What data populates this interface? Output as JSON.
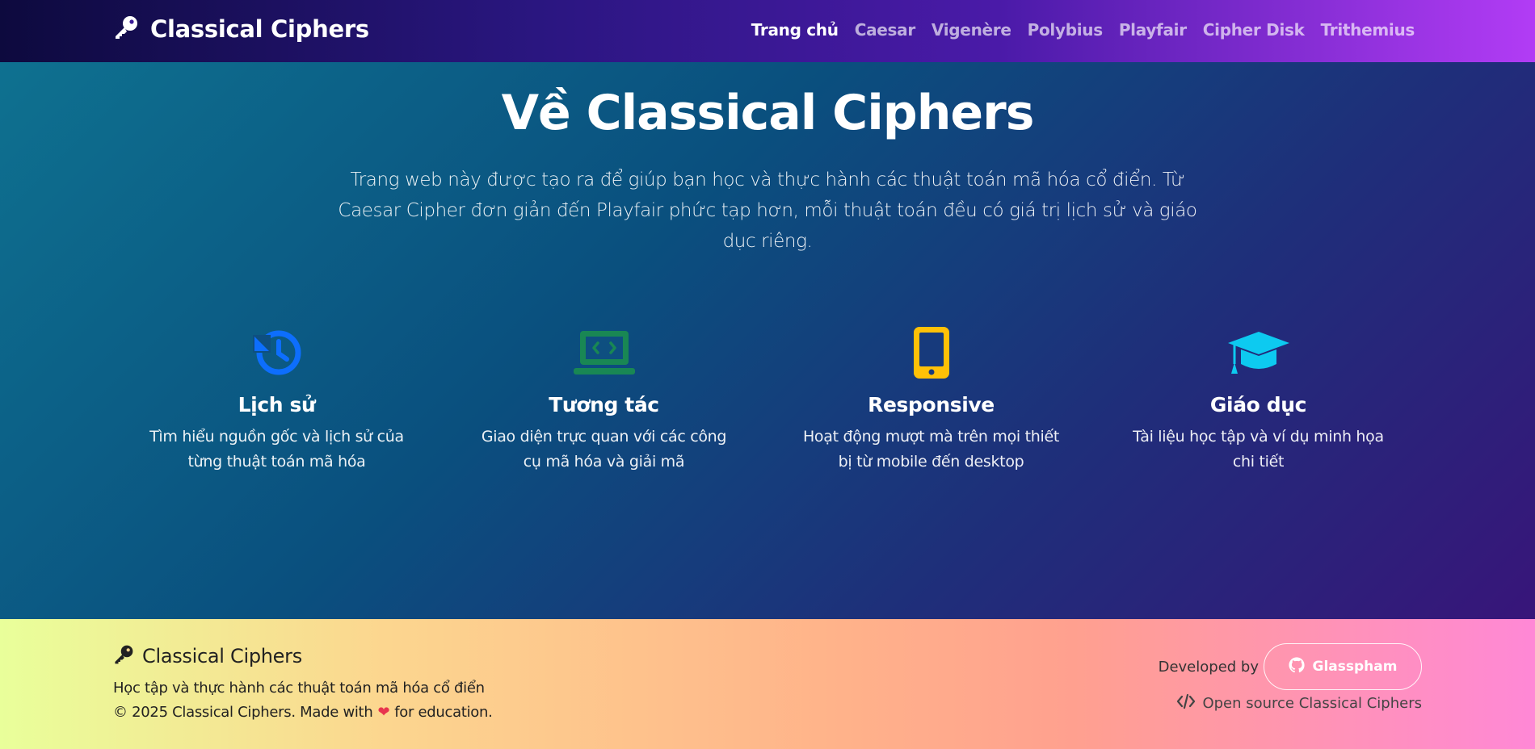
{
  "nav": {
    "brand": "Classical Ciphers",
    "brand_icon": "key-icon",
    "links": [
      {
        "label": "Trang chủ",
        "active": true
      },
      {
        "label": "Caesar",
        "active": false
      },
      {
        "label": "Vigenère",
        "active": false
      },
      {
        "label": "Polybius",
        "active": false
      },
      {
        "label": "Playfair",
        "active": false
      },
      {
        "label": "Cipher Disk",
        "active": false
      },
      {
        "label": "Trithemius",
        "active": false
      }
    ]
  },
  "hero": {
    "title": "Về Classical Ciphers",
    "lead": "Trang web này được tạo ra để giúp bạn học và thực hành các thuật toán mã hóa cổ điển. Từ Caesar Cipher đơn giản đến Playfair phức tạp hơn, mỗi thuật toán đều có giá trị lịch sử và giáo dục riêng."
  },
  "features": [
    {
      "icon": "history-icon",
      "color": "#0d6efd",
      "title": "Lịch sử",
      "text": "Tìm hiểu nguồn gốc và lịch sử của từng thuật toán mã hóa"
    },
    {
      "icon": "laptop-code-icon",
      "color": "#198754",
      "title": "Tương tác",
      "text": "Giao diện trực quan với các công cụ mã hóa và giải mã"
    },
    {
      "icon": "mobile-icon",
      "color": "#ffc107",
      "title": "Responsive",
      "text": "Hoạt động mượt mà trên mọi thiết bị từ mobile đến desktop"
    },
    {
      "icon": "graduation-cap-icon",
      "color": "#0dcaf0",
      "title": "Giáo dục",
      "text": "Tài liệu học tập và ví dụ minh họa chi tiết"
    }
  ],
  "footer": {
    "brand": "Classical Ciphers",
    "description": "Học tập và thực hành các thuật toán mã hóa cổ điển",
    "copyright_before": "© 2025 Classical Ciphers. Made with",
    "copyright_after": "for education.",
    "developed_by": "Developed by",
    "github_button": "Glasspham",
    "open_source": "Open source Classical Ciphers"
  }
}
